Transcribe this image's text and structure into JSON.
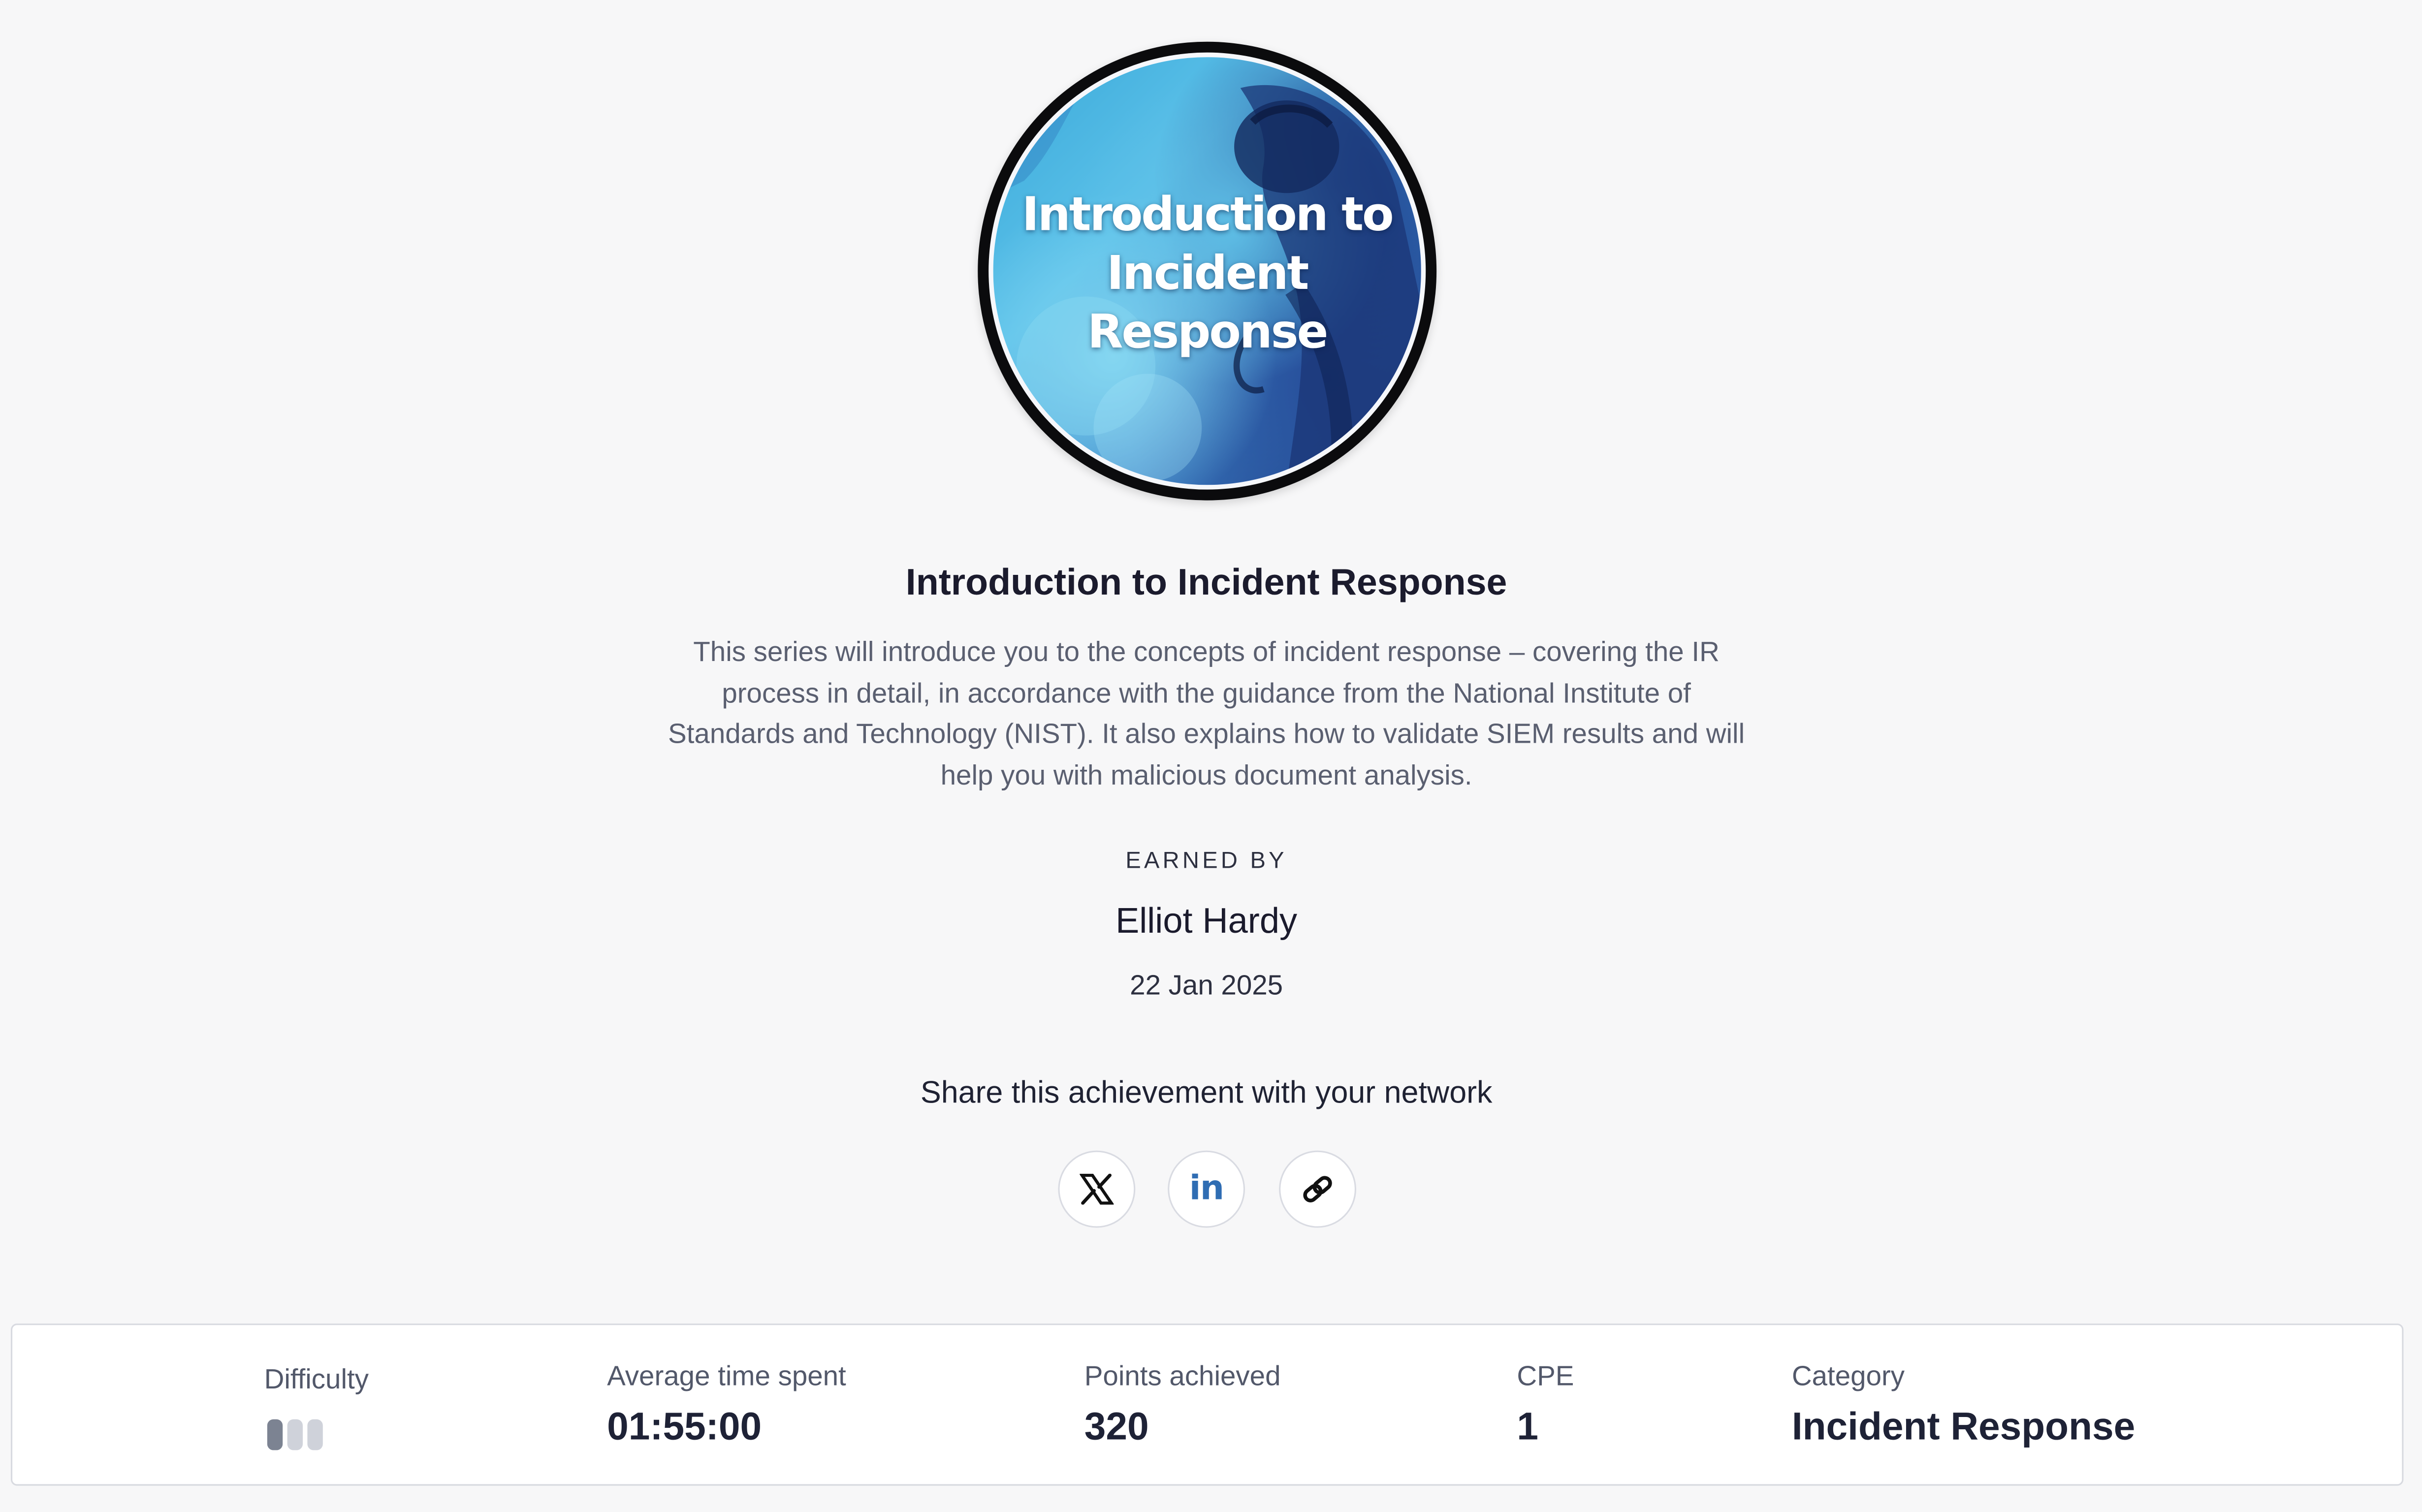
{
  "badge": {
    "title": "Introduction to\nIncident\nResponse"
  },
  "title": "Introduction to Incident Response",
  "description": "This series will introduce you to the concepts of incident response – covering the IR process in detail, in accordance with the guidance from the National Institute of Standards and Technology (NIST). It also explains how to validate SIEM results and will help you with malicious document analysis.",
  "earned": {
    "label": "EARNED BY",
    "name": "Elliot Hardy",
    "date": "22 Jan 2025"
  },
  "share": {
    "heading": "Share this achievement with your network",
    "buttons": [
      {
        "icon": "x-icon"
      },
      {
        "icon": "linkedin-icon",
        "glyph": "in"
      },
      {
        "icon": "link-icon"
      }
    ]
  },
  "stats": {
    "difficulty": {
      "label": "Difficulty",
      "level": 1,
      "max": 3
    },
    "avg_time": {
      "label": "Average time spent",
      "value": "01:55:00"
    },
    "points": {
      "label": "Points achieved",
      "value": "320"
    },
    "cpe": {
      "label": "CPE",
      "value": "1"
    },
    "category": {
      "label": "Category",
      "value": "Incident Response"
    }
  },
  "colors": {
    "background": "#f7f7f8",
    "linkedin": "#2f6db3",
    "difficulty_active": "#7c8392",
    "difficulty_inactive": "#cfd2da"
  }
}
